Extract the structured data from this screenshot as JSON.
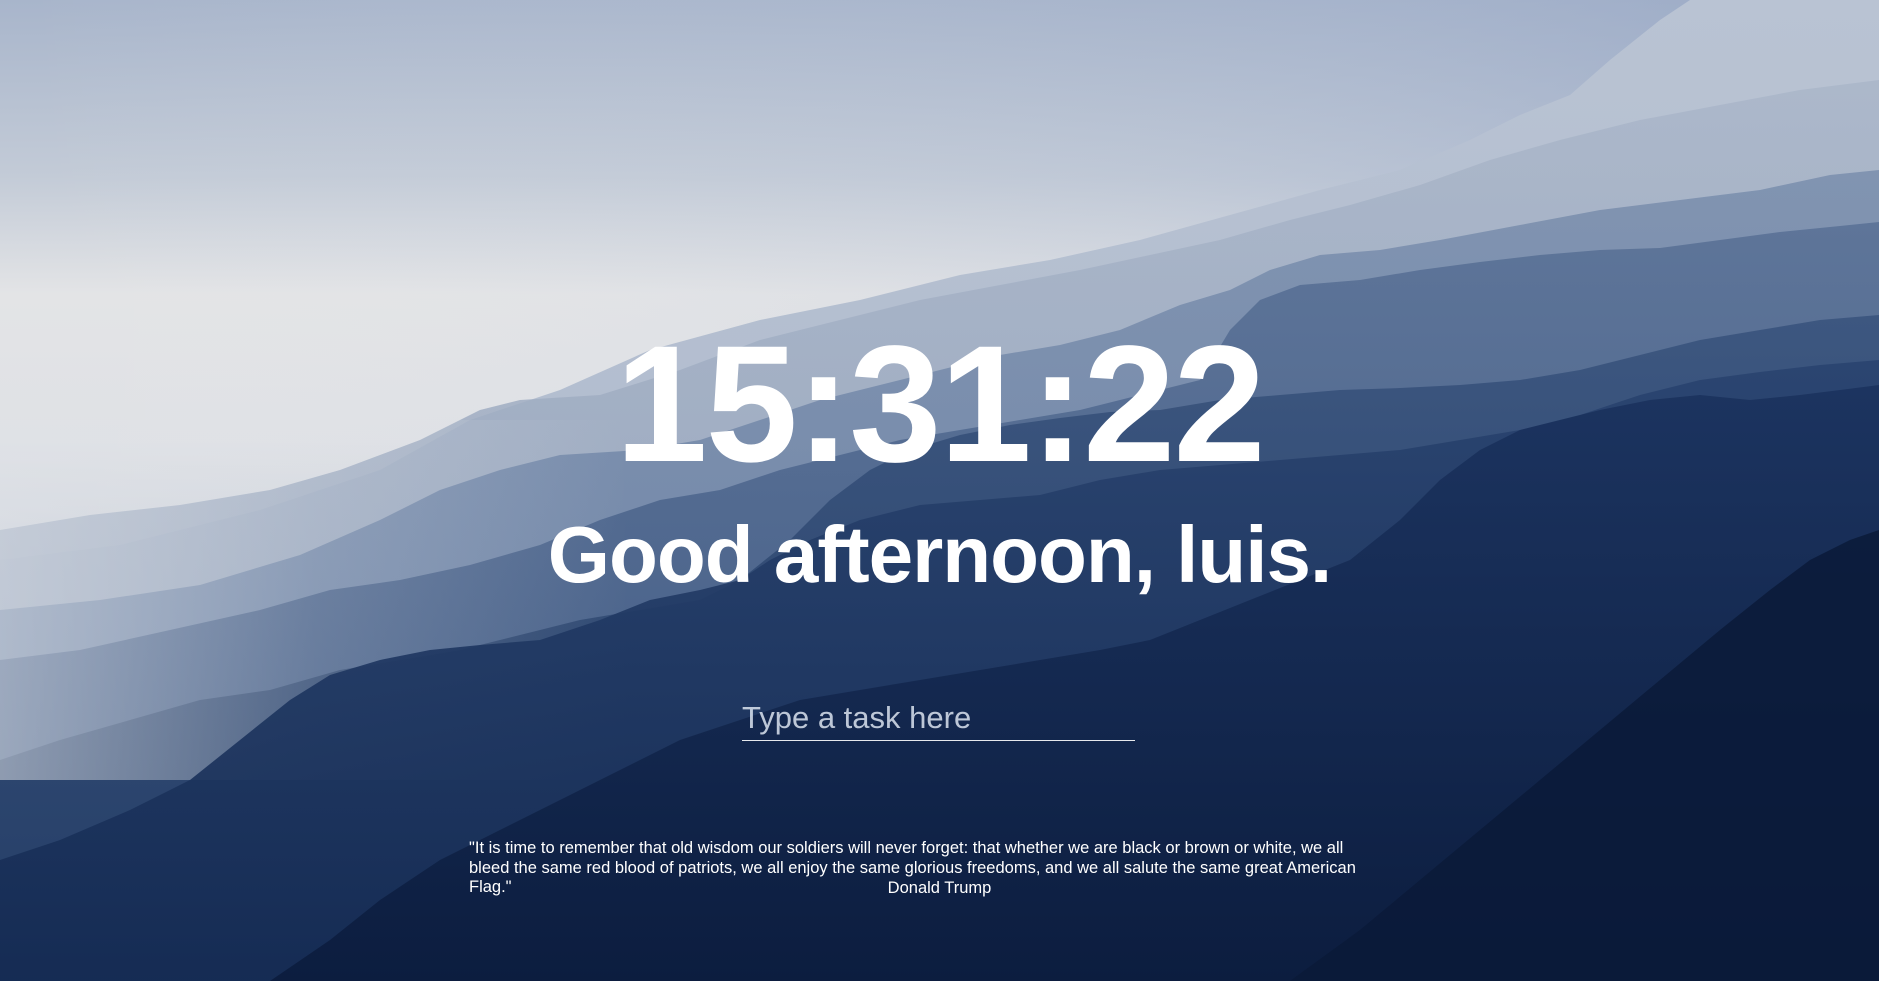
{
  "clock": {
    "time": "15:31:22"
  },
  "greeting": {
    "text": "Good afternoon, luis."
  },
  "task": {
    "value": "",
    "placeholder": "Type a task here"
  },
  "quote": {
    "text": "\"It is time to remember that old wisdom our soldiers will never forget: that whether we are black or brown or white, we all bleed the same red blood of patriots, we all enjoy the same glorious freedoms, and we all salute the same great American Flag.\"",
    "author": "Donald Trump"
  },
  "background": {
    "description_icon": "misty-mountain-landscape",
    "sky_top_color": "#a9b6cc",
    "haze_color": "#e4e6e9",
    "mountain_dark_color": "#0f2245",
    "mountain_mid_color": "#3f5a82"
  }
}
